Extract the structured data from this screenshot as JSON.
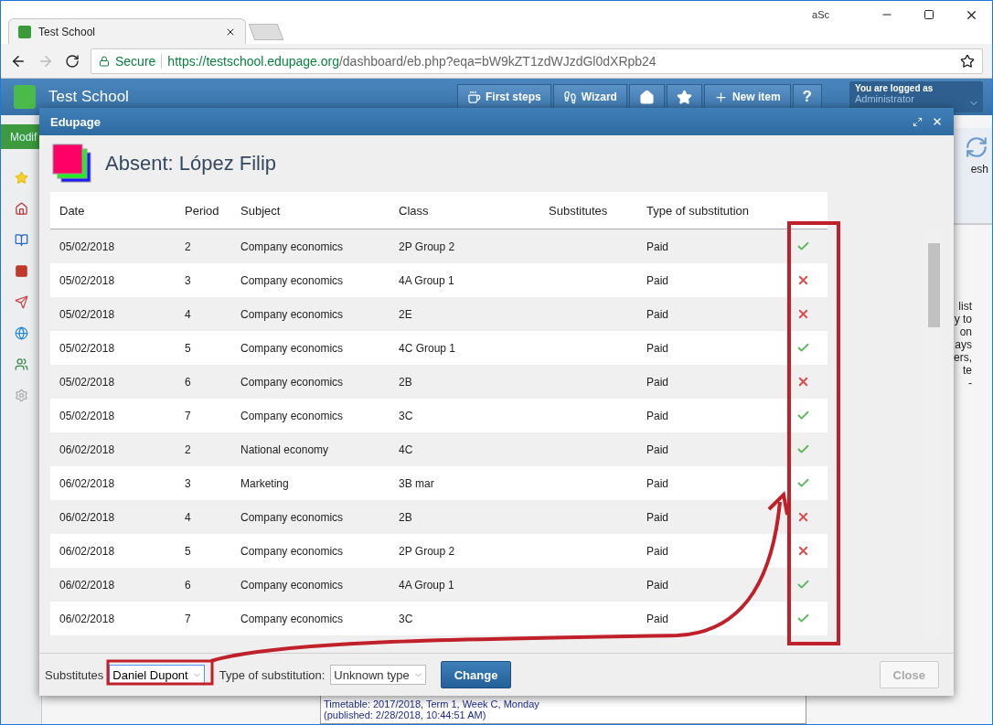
{
  "browser": {
    "tab_title": "Test School",
    "profile": "aSc",
    "secure_label": "Secure",
    "url_host": "https://testschool.edupage.org",
    "url_path": "/dashboard/eb.php?eqa=bW9kZT1zdWJzdGl0dXRpb24"
  },
  "app_header": {
    "title": "Test School",
    "buttons": [
      {
        "kind": "text",
        "label": "First steps"
      },
      {
        "kind": "text",
        "label": "Wizard"
      },
      {
        "kind": "icon"
      },
      {
        "kind": "icon"
      },
      {
        "kind": "text",
        "label": "New item"
      },
      {
        "kind": "char",
        "label": "?"
      }
    ],
    "user": {
      "caption": "You are logged as",
      "name": "Administrator"
    }
  },
  "background": {
    "modify_button": "Modif",
    "refresh_label": "esh",
    "side_text": [
      "list",
      "y to",
      "on",
      "ays",
      "ers,",
      "te",
      "-"
    ],
    "timetable_lines": [
      "Timetable: 2017/2018, Term 1, Week C, Monday",
      "(published: 2/28/2018, 10:44:51 AM)"
    ]
  },
  "dialog": {
    "title": "Edupage",
    "heading": "Absent: López Filip",
    "columns": [
      "Date",
      "Period",
      "Subject",
      "Class",
      "Substitutes",
      "Type of substitution"
    ],
    "rows": [
      {
        "date": "05/02/2018",
        "period": "2",
        "subject": "Company economics",
        "class": "2P Group 2",
        "type": "Paid",
        "ok": true
      },
      {
        "date": "05/02/2018",
        "period": "3",
        "subject": "Company economics",
        "class": "4A Group 1",
        "type": "Paid",
        "ok": false
      },
      {
        "date": "05/02/2018",
        "period": "4",
        "subject": "Company economics",
        "class": "2E",
        "type": "Paid",
        "ok": false
      },
      {
        "date": "05/02/2018",
        "period": "5",
        "subject": "Company economics",
        "class": "4C Group 1",
        "type": "Paid",
        "ok": true
      },
      {
        "date": "05/02/2018",
        "period": "6",
        "subject": "Company economics",
        "class": "2B",
        "type": "Paid",
        "ok": false
      },
      {
        "date": "05/02/2018",
        "period": "7",
        "subject": "Company economics",
        "class": "3C",
        "type": "Paid",
        "ok": true
      },
      {
        "date": "06/02/2018",
        "period": "2",
        "subject": "National economy",
        "class": "4C",
        "type": "Paid",
        "ok": true
      },
      {
        "date": "06/02/2018",
        "period": "3",
        "subject": "Marketing",
        "class": "3B mar",
        "type": "Paid",
        "ok": true
      },
      {
        "date": "06/02/2018",
        "period": "4",
        "subject": "Company economics",
        "class": "2B",
        "type": "Paid",
        "ok": false
      },
      {
        "date": "06/02/2018",
        "period": "5",
        "subject": "Company economics",
        "class": "2P Group 2",
        "type": "Paid",
        "ok": false
      },
      {
        "date": "06/02/2018",
        "period": "6",
        "subject": "Company economics",
        "class": "4A Group 1",
        "type": "Paid",
        "ok": true
      },
      {
        "date": "06/02/2018",
        "period": "7",
        "subject": "Company economics",
        "class": "3C",
        "type": "Paid",
        "ok": true
      }
    ],
    "footer": {
      "substitutes_label": "Substitutes",
      "substitute_value": "Daniel Dupont",
      "type_label": "Type of substitution:",
      "type_value": "Unknown type",
      "change_button": "Change",
      "close_button": "Close"
    }
  }
}
